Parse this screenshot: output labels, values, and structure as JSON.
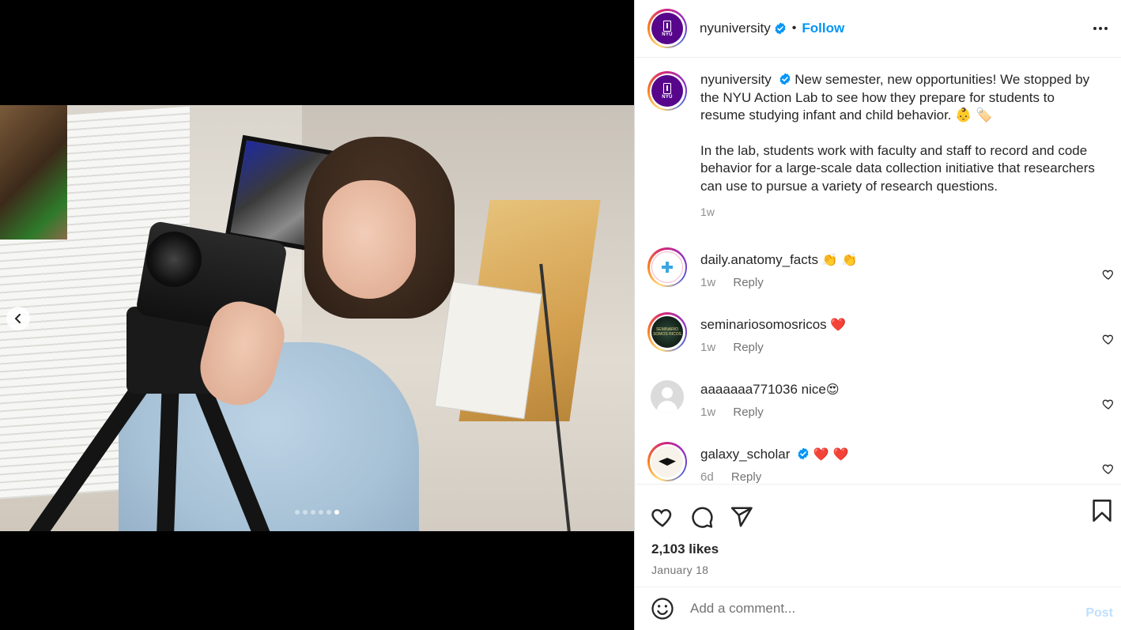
{
  "post": {
    "username": "nyuniversity",
    "follow_label": "Follow",
    "separator": "•",
    "avatar_text": "NYU"
  },
  "carousel": {
    "dot_count": 6,
    "active_dot": 5
  },
  "caption": {
    "username": "nyuniversity",
    "paragraph1": "New semester, new opportunities! We stopped by the NYU Action Lab to see how they prepare for students to resume studying infant and child behavior. 👶 🏷️",
    "paragraph2": "In the lab, students work with faculty and staff to record and code behavior for a large-scale data collection initiative that researchers can use to pursue a variety of research questions.",
    "time": "1w"
  },
  "comments": [
    {
      "username": "daily.anatomy_facts",
      "verified": false,
      "text": "",
      "emoji": "👏 👏",
      "time": "1w",
      "reply": "Reply"
    },
    {
      "username": "seminariosomosricos",
      "verified": false,
      "text": "",
      "emoji": "❤️",
      "time": "1w",
      "reply": "Reply"
    },
    {
      "username": "aaaaaaa771036",
      "verified": false,
      "text": "nice",
      "emoji": "😍",
      "time": "1w",
      "reply": "Reply"
    },
    {
      "username": "galaxy_scholar",
      "verified": true,
      "text": "",
      "emoji": "❤️ ❤️",
      "time": "6d",
      "reply": "Reply"
    }
  ],
  "avatars": {
    "semi_text": "SEMINARIO SOMOS RICOS"
  },
  "actions": {
    "likes": "2,103 likes",
    "date": "January 18"
  },
  "add_comment": {
    "placeholder": "Add a comment...",
    "post_label": "Post"
  },
  "icons": [
    "verified-icon",
    "more-options-icon",
    "carousel-prev-icon",
    "like-heart-icon",
    "comment-icon",
    "share-icon",
    "bookmark-icon",
    "emoji-icon",
    "comment-like-icon"
  ],
  "colors": {
    "brand_purple": "#57068c",
    "link_blue": "#0095f6",
    "post_disabled": "#c0dffd",
    "secondary_text": "#737373"
  }
}
